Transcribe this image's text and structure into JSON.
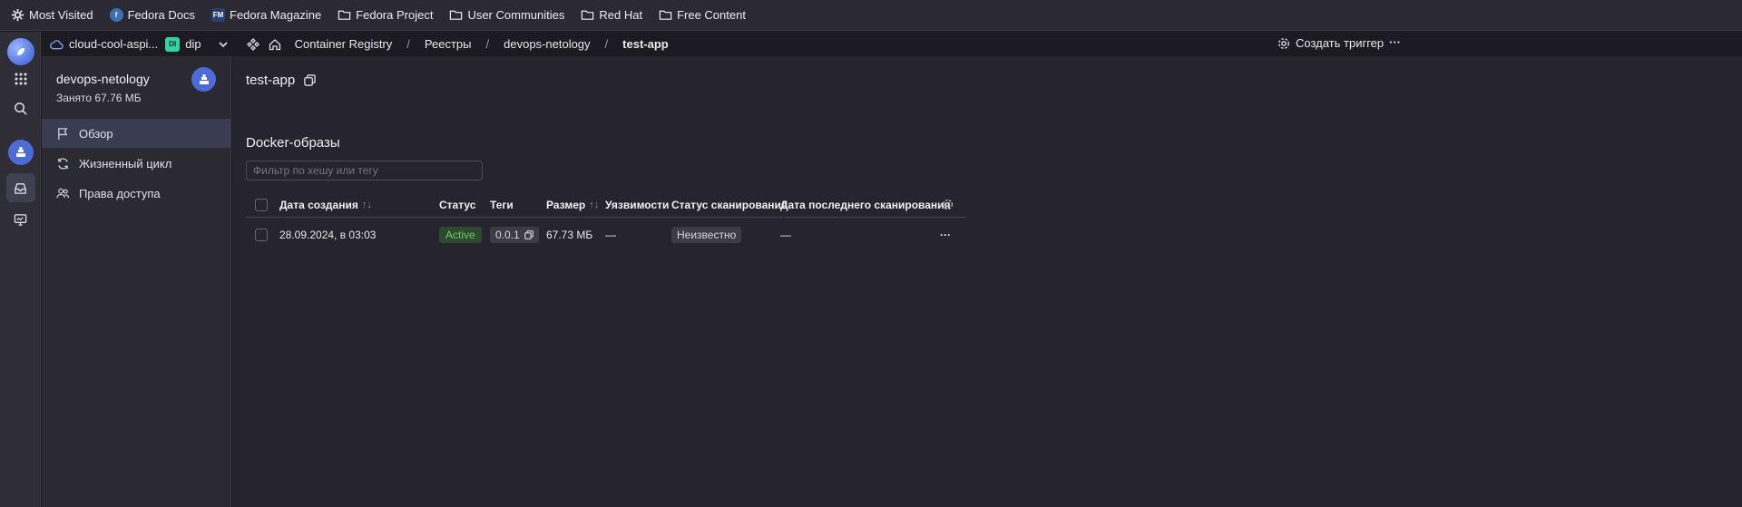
{
  "bookmarks": [
    {
      "label": "Most Visited",
      "icon": "gear-icon"
    },
    {
      "label": "Fedora Docs",
      "icon": "fedora-icon"
    },
    {
      "label": "Fedora Magazine",
      "icon": "fm-icon"
    },
    {
      "label": "Fedora Project",
      "icon": "folder-icon"
    },
    {
      "label": "User Communities",
      "icon": "folder-icon"
    },
    {
      "label": "Red Hat",
      "icon": "folder-icon"
    },
    {
      "label": "Free Content",
      "icon": "folder-icon"
    }
  ],
  "header": {
    "cloud": "cloud-cool-aspi...",
    "folder_badge": "DI",
    "folder": "dip",
    "breadcrumbs": [
      "Container Registry",
      "Реестры",
      "devops-netology",
      "test-app"
    ],
    "create_trigger": "Создать триггер",
    "more": "···"
  },
  "sidebar": {
    "registry_name": "devops-netology",
    "used_space": "Занято 67.76 МБ",
    "items": [
      {
        "label": "Обзор",
        "icon": "flag-icon",
        "active": true
      },
      {
        "label": "Жизненный цикл",
        "icon": "refresh-icon"
      },
      {
        "label": "Права доступа",
        "icon": "users-icon"
      }
    ]
  },
  "main": {
    "title": "test-app",
    "section_title": "Docker-образы",
    "filter_placeholder": "Фильтр по хешу или тегу",
    "columns": [
      "Дата создания",
      "Статус",
      "Теги",
      "Размер",
      "Уязвимости",
      "Статус сканирования",
      "Дата последнего сканирования"
    ],
    "sort_glyph": "↑↓",
    "rows": [
      {
        "created": "28.09.2024, в 03:03",
        "status": "Active",
        "tag": "0.0.1",
        "size": "67.73 МБ",
        "vulns": "—",
        "scan_status": "Неизвестно",
        "last_scan": "—",
        "actions": "···"
      }
    ]
  },
  "colors": {
    "accent": "#4d6bd6",
    "active_status": "#6ccb6a",
    "background": "#26252d"
  }
}
